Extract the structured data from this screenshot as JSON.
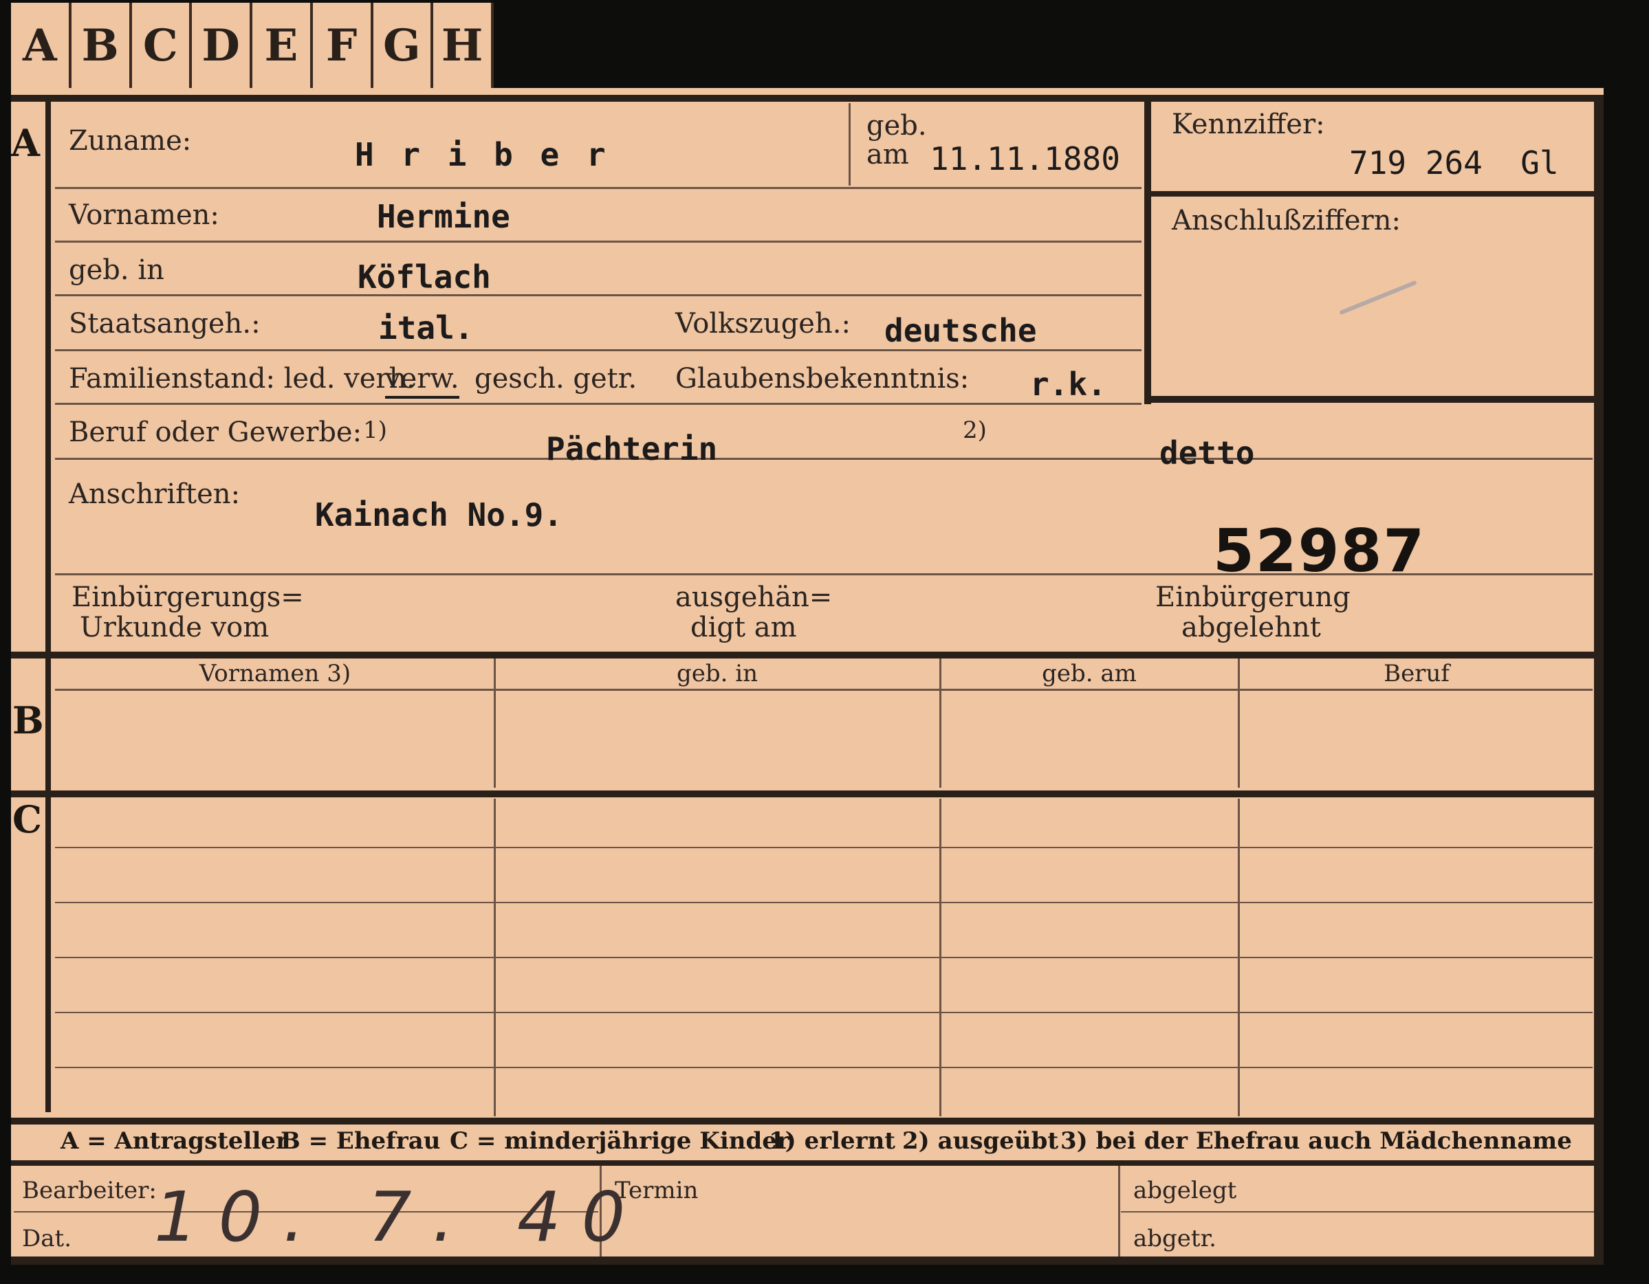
{
  "tabs": [
    "A",
    "B",
    "C",
    "D",
    "E",
    "F",
    "G",
    "H"
  ],
  "sections": {
    "a": "A",
    "b": "B",
    "c": "C"
  },
  "labels": {
    "zuname": "Zuname:",
    "geb": "geb.",
    "am": "am",
    "kennziffer": "Kennziffer:",
    "anschlussziffern": "Anschlußziffern:",
    "vornamen": "Vornamen:",
    "geb_in": "geb. in",
    "staatsangeh": "Staatsangeh.:",
    "volkszugeh": "Volkszugeh.:",
    "familienstand": "Familienstand: led. verh.",
    "familienstand_verw": "verw.",
    "familienstand_rest": "gesch. getr.",
    "glaubensbekenntnis": "Glaubensbekenntnis:",
    "beruf": "Beruf oder Gewerbe:",
    "fn1": "1)",
    "fn2": "2)",
    "anschriften": "Anschriften:",
    "einb_1": "Einbürgerungs=",
    "einb_2": "Urkunde vom",
    "ausg_1": "ausgehän=",
    "ausg_2": "digt am",
    "abg_1": "Einbürgerung",
    "abg_2": "abgelehnt"
  },
  "values": {
    "zuname": "H r i b e r",
    "geburtsdatum": "11.11.1880",
    "kennziffer": "719 264  Gl",
    "vornamen": "Hermine",
    "geburtsort": "Köflach",
    "staatsangehoerigkeit": "ital.",
    "volkszugehoerigkeit": "deutsche",
    "glaubensbekenntnis": "r.k.",
    "beruf_erlernt": "Pächterin",
    "beruf_ausgeuebt": "detto",
    "anschrift": "Kainach No.9.",
    "stamp_number": "52987"
  },
  "table_headers": [
    "Vornamen 3)",
    "geb. in",
    "geb. am",
    "Beruf"
  ],
  "legend": {
    "a": "A = Antragsteller",
    "b": "B = Ehefrau",
    "c": "C = minderjährige Kinder",
    "f1": "1) erlernt",
    "f2": "2) ausgeübt",
    "f3": "3) bei der Ehefrau auch Mädchenname"
  },
  "footer": {
    "bearbeiter": "Bearbeiter:",
    "dat": "Dat.",
    "termin": "Termin",
    "abgelegt": "abgelegt",
    "abgetr": "abgetr.",
    "handwritten_date": "10. 7. 40"
  },
  "colors": {
    "card": "#efc5a2",
    "ink": "#2a201a"
  }
}
